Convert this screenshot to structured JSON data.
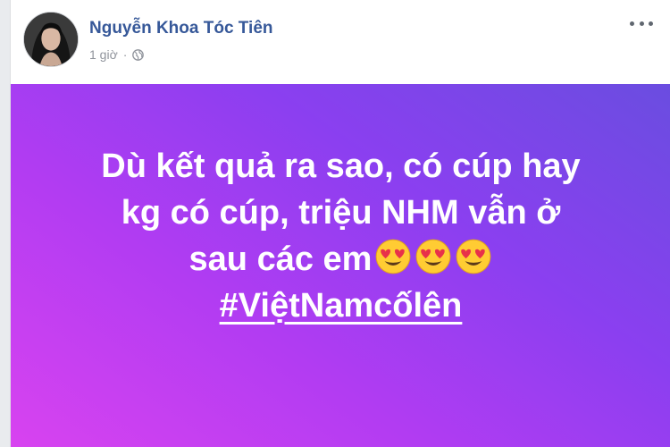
{
  "post": {
    "author_name": "Nguyễn Khoa Tóc Tiên",
    "timestamp": "1 giờ",
    "separator": "·",
    "privacy_icon": "globe-icon",
    "more_icon": "more-options-icon",
    "text_lines": [
      "Dù kết quả ra sao, có cúp hay",
      "kg có cúp, triệu NHM vẫn ở",
      "sau các em"
    ],
    "emojis": [
      "heart-eyes-emoji",
      "heart-eyes-emoji",
      "heart-eyes-emoji"
    ],
    "hashtag": "#ViệtNamcốlên",
    "background_gradient": [
      "#6a4de0",
      "#8b3ff0",
      "#b23cf2",
      "#d843f0"
    ],
    "author_color": "#365899"
  }
}
